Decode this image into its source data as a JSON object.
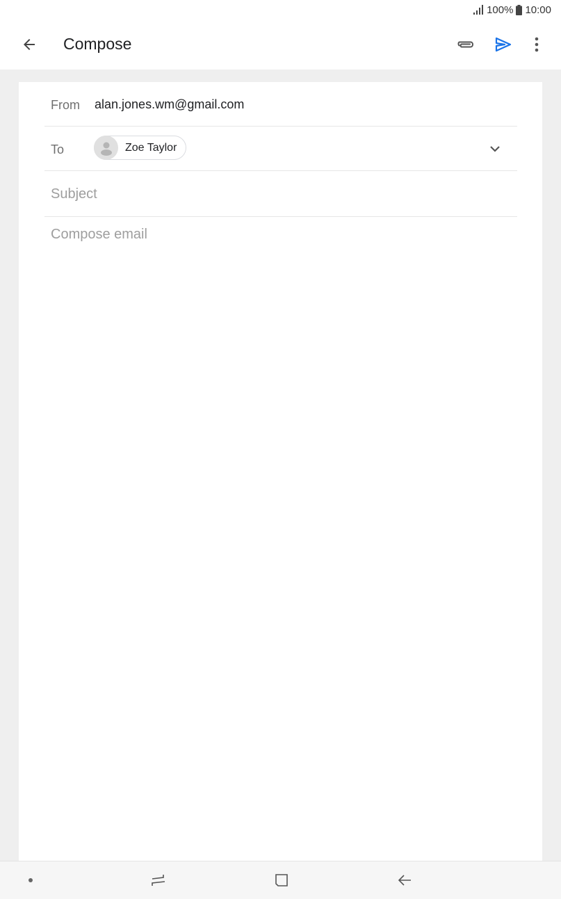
{
  "status_bar": {
    "battery": "100%",
    "time": "10:00"
  },
  "app_bar": {
    "title": "Compose",
    "icons": {
      "back": "arrow-back-icon",
      "attach": "paperclip-icon",
      "send": "send-icon",
      "more": "more-vert-icon"
    },
    "accent_color": "#1a73e8"
  },
  "compose": {
    "from_label": "From",
    "from_value": "alan.jones.wm@gmail.com",
    "to_label": "To",
    "recipients": [
      {
        "name": "Zoe Taylor",
        "icon": "person-avatar-icon"
      }
    ],
    "subject_placeholder": "Subject",
    "subject_value": "",
    "body_placeholder": "Compose email",
    "body_value": ""
  },
  "nav_bar": {
    "icons": [
      "dot-icon",
      "recents-icon",
      "home-icon",
      "back-icon"
    ]
  }
}
